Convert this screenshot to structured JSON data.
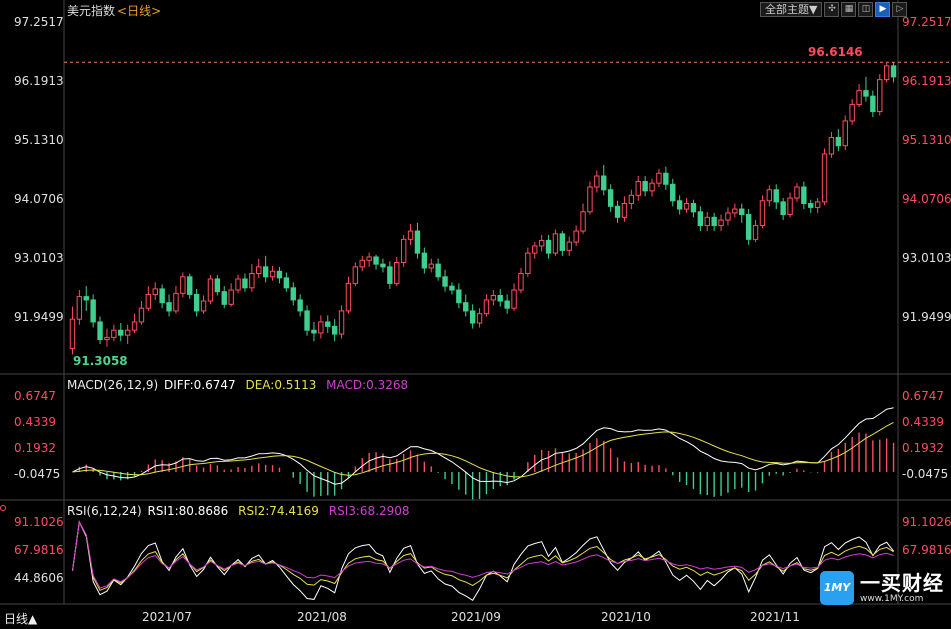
{
  "header": {
    "instrument": "美元指数",
    "period": "<日线>",
    "theme_select": "全部主题▼",
    "toolbar_icons": [
      "crosshair-icon",
      "grid-icon",
      "split-icon",
      "play-icon",
      "next-icon"
    ]
  },
  "price_axis": [
    "97.2517",
    "96.1913",
    "95.1310",
    "94.0706",
    "93.0103",
    "91.9499"
  ],
  "price_high_label": "96.6146",
  "price_low_label": "91.3058",
  "macd": {
    "title": "MACD(26,12,9)",
    "diff": "DIFF:0.6747",
    "dea": "DEA:0.5113",
    "macd": "MACD:0.3268",
    "axis": [
      "0.6747",
      "0.4339",
      "0.1932",
      "-0.0475"
    ]
  },
  "rsi": {
    "title": "RSI(6,12,24)",
    "rsi1": "RSI1:80.8686",
    "rsi2": "RSI2:74.4169",
    "rsi3": "RSI3:68.2908",
    "axis": [
      "91.1026",
      "67.9816",
      "44.8606"
    ]
  },
  "x_axis": [
    "2021/07",
    "2021/08",
    "2021/09",
    "2021/10",
    "2021/11"
  ],
  "bottom_tab": "日线▲",
  "logo": {
    "mark": "1MY",
    "name": "一买财经",
    "url": "www.1MY.com"
  },
  "colors": {
    "up": "#ff4d5e",
    "down": "#3ecf8e",
    "diff": "#ffffff",
    "dea": "#e6e04a",
    "macd": "#d040d0"
  },
  "chart_data": {
    "type": "candlestick",
    "title": "美元指数",
    "ylim": [
      90.9,
      97.5
    ],
    "candles": [
      [
        91.42,
        91.95,
        91.31,
        92.18
      ],
      [
        91.95,
        92.36,
        91.85,
        92.48
      ],
      [
        92.36,
        92.3,
        92.1,
        92.55
      ],
      [
        92.3,
        91.9,
        91.8,
        92.4
      ],
      [
        91.9,
        91.58,
        91.5,
        92.0
      ],
      [
        91.58,
        91.62,
        91.45,
        91.78
      ],
      [
        91.62,
        91.75,
        91.55,
        91.85
      ],
      [
        91.75,
        91.66,
        91.55,
        91.88
      ],
      [
        91.66,
        91.75,
        91.5,
        91.85
      ],
      [
        91.75,
        91.9,
        91.7,
        92.05
      ],
      [
        91.9,
        92.15,
        91.85,
        92.28
      ],
      [
        92.15,
        92.4,
        92.1,
        92.55
      ],
      [
        92.4,
        92.5,
        92.3,
        92.62
      ],
      [
        92.5,
        92.25,
        92.15,
        92.58
      ],
      [
        92.25,
        92.1,
        92.0,
        92.4
      ],
      [
        92.1,
        92.42,
        92.05,
        92.55
      ],
      [
        92.42,
        92.72,
        92.35,
        92.8
      ],
      [
        92.72,
        92.4,
        92.32,
        92.78
      ],
      [
        92.4,
        92.1,
        92.0,
        92.5
      ],
      [
        92.1,
        92.28,
        92.05,
        92.38
      ],
      [
        92.28,
        92.68,
        92.22,
        92.75
      ],
      [
        92.68,
        92.45,
        92.38,
        92.75
      ],
      [
        92.45,
        92.22,
        92.15,
        92.55
      ],
      [
        92.22,
        92.48,
        92.18,
        92.6
      ],
      [
        92.48,
        92.68,
        92.42,
        92.76
      ],
      [
        92.68,
        92.52,
        92.45,
        92.78
      ],
      [
        92.52,
        92.78,
        92.45,
        92.95
      ],
      [
        92.78,
        92.9,
        92.7,
        93.05
      ],
      [
        92.9,
        92.72,
        92.62,
        93.1
      ],
      [
        92.72,
        92.82,
        92.65,
        92.92
      ],
      [
        92.82,
        92.7,
        92.6,
        92.9
      ],
      [
        92.7,
        92.52,
        92.45,
        92.8
      ],
      [
        92.52,
        92.3,
        92.2,
        92.62
      ],
      [
        92.3,
        92.1,
        92.0,
        92.4
      ],
      [
        92.1,
        91.75,
        91.65,
        92.2
      ],
      [
        91.75,
        91.7,
        91.55,
        91.9
      ],
      [
        91.7,
        91.9,
        91.6,
        92.02
      ],
      [
        91.9,
        91.82,
        91.7,
        92.02
      ],
      [
        91.82,
        91.68,
        91.55,
        91.95
      ],
      [
        91.68,
        92.1,
        91.6,
        92.2
      ],
      [
        92.1,
        92.6,
        92.05,
        92.72
      ],
      [
        92.6,
        92.9,
        92.55,
        92.98
      ],
      [
        92.9,
        93.02,
        92.82,
        93.1
      ],
      [
        93.02,
        93.08,
        92.9,
        93.16
      ],
      [
        93.08,
        92.95,
        92.85,
        93.12
      ],
      [
        92.95,
        92.9,
        92.8,
        93.05
      ],
      [
        92.9,
        92.6,
        92.5,
        93.0
      ],
      [
        92.6,
        92.98,
        92.55,
        93.08
      ],
      [
        92.98,
        93.4,
        92.9,
        93.48
      ],
      [
        93.4,
        93.55,
        93.3,
        93.68
      ],
      [
        93.55,
        93.15,
        93.05,
        93.7
      ],
      [
        93.15,
        92.88,
        92.78,
        93.25
      ],
      [
        92.88,
        92.95,
        92.8,
        93.05
      ],
      [
        92.95,
        92.72,
        92.65,
        93.05
      ],
      [
        92.72,
        92.55,
        92.45,
        92.85
      ],
      [
        92.55,
        92.48,
        92.4,
        92.62
      ],
      [
        92.48,
        92.25,
        92.15,
        92.6
      ],
      [
        92.25,
        92.1,
        92.0,
        92.4
      ],
      [
        92.1,
        91.88,
        91.78,
        92.22
      ],
      [
        91.88,
        92.05,
        91.8,
        92.15
      ],
      [
        92.05,
        92.3,
        92.0,
        92.4
      ],
      [
        92.3,
        92.38,
        92.2,
        92.48
      ],
      [
        92.38,
        92.28,
        92.18,
        92.5
      ],
      [
        92.28,
        92.15,
        92.05,
        92.4
      ],
      [
        92.15,
        92.48,
        92.1,
        92.6
      ],
      [
        92.48,
        92.78,
        92.42,
        92.88
      ],
      [
        92.78,
        93.15,
        92.72,
        93.25
      ],
      [
        93.15,
        93.28,
        93.05,
        93.35
      ],
      [
        93.28,
        93.38,
        93.18,
        93.48
      ],
      [
        93.38,
        93.15,
        93.05,
        93.48
      ],
      [
        93.15,
        93.5,
        93.1,
        93.58
      ],
      [
        93.5,
        93.2,
        93.1,
        93.55
      ],
      [
        93.2,
        93.35,
        93.1,
        93.45
      ],
      [
        93.35,
        93.55,
        93.28,
        93.65
      ],
      [
        93.55,
        93.9,
        93.5,
        94.05
      ],
      [
        93.9,
        94.35,
        93.85,
        94.45
      ],
      [
        94.35,
        94.55,
        94.25,
        94.65
      ],
      [
        94.55,
        94.3,
        94.2,
        94.75
      ],
      [
        94.3,
        94.0,
        93.9,
        94.4
      ],
      [
        94.0,
        93.8,
        93.7,
        94.1
      ],
      [
        93.8,
        94.05,
        93.72,
        94.18
      ],
      [
        94.05,
        94.2,
        93.95,
        94.3
      ],
      [
        94.2,
        94.45,
        94.1,
        94.55
      ],
      [
        94.45,
        94.28,
        94.18,
        94.55
      ],
      [
        94.28,
        94.42,
        94.18,
        94.5
      ],
      [
        94.42,
        94.6,
        94.35,
        94.68
      ],
      [
        94.6,
        94.4,
        94.3,
        94.72
      ],
      [
        94.4,
        94.1,
        94.0,
        94.5
      ],
      [
        94.1,
        93.95,
        93.85,
        94.2
      ],
      [
        93.95,
        94.05,
        93.88,
        94.15
      ],
      [
        94.05,
        93.9,
        93.8,
        94.12
      ],
      [
        93.9,
        93.65,
        93.55,
        94.0
      ],
      [
        93.65,
        93.8,
        93.55,
        93.9
      ],
      [
        93.8,
        93.65,
        93.55,
        93.88
      ],
      [
        93.65,
        93.75,
        93.55,
        93.85
      ],
      [
        93.75,
        93.88,
        93.65,
        93.98
      ],
      [
        93.88,
        93.95,
        93.8,
        94.05
      ],
      [
        93.95,
        93.85,
        93.7,
        94.05
      ],
      [
        93.85,
        93.4,
        93.3,
        93.95
      ],
      [
        93.4,
        93.65,
        93.35,
        93.75
      ],
      [
        93.65,
        94.1,
        93.6,
        94.2
      ],
      [
        94.1,
        94.3,
        94.0,
        94.38
      ],
      [
        94.3,
        94.08,
        93.95,
        94.4
      ],
      [
        94.08,
        93.85,
        93.75,
        94.15
      ],
      [
        93.85,
        94.15,
        93.8,
        94.25
      ],
      [
        94.15,
        94.35,
        94.08,
        94.42
      ],
      [
        94.35,
        94.05,
        93.95,
        94.45
      ],
      [
        94.05,
        93.98,
        93.88,
        94.12
      ],
      [
        93.98,
        94.08,
        93.88,
        94.15
      ],
      [
        94.08,
        94.95,
        94.02,
        95.05
      ],
      [
        94.95,
        95.25,
        94.88,
        95.35
      ],
      [
        95.25,
        95.1,
        95.0,
        95.4
      ],
      [
        95.1,
        95.55,
        95.02,
        95.65
      ],
      [
        95.55,
        95.85,
        95.48,
        95.95
      ],
      [
        95.85,
        96.1,
        95.8,
        96.22
      ],
      [
        96.1,
        96.0,
        95.9,
        96.35
      ],
      [
        96.0,
        95.72,
        95.62,
        96.1
      ],
      [
        95.72,
        96.3,
        95.65,
        96.4
      ],
      [
        96.3,
        96.55,
        96.25,
        96.62
      ],
      [
        96.55,
        96.35,
        96.25,
        96.62
      ]
    ]
  }
}
